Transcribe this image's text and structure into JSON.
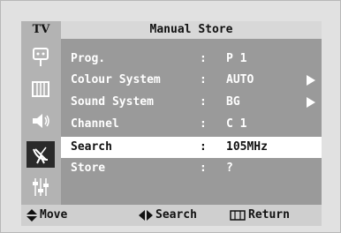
{
  "header": {
    "source": "TV",
    "title": "Manual Store"
  },
  "sidebar": {
    "icons": [
      {
        "name": "input-icon"
      },
      {
        "name": "picture-icon"
      },
      {
        "name": "sound-icon"
      },
      {
        "name": "channel-icon",
        "active": true
      },
      {
        "name": "setup-icon"
      }
    ]
  },
  "menu": {
    "rows": [
      {
        "label": "Prog.",
        "colon": ":",
        "value": "P 1",
        "has_arrow": false
      },
      {
        "label": "Colour System",
        "colon": ":",
        "value": "AUTO",
        "has_arrow": true
      },
      {
        "label": "Sound System",
        "colon": ":",
        "value": "BG",
        "has_arrow": true
      },
      {
        "label": "Channel",
        "colon": ":",
        "value": "C 1",
        "has_arrow": false
      },
      {
        "label": "Search",
        "colon": ":",
        "value": "105MHz",
        "has_arrow": false,
        "selected": true
      },
      {
        "label": "Store",
        "colon": ":",
        "value": "?",
        "has_arrow": false
      }
    ]
  },
  "help": {
    "move_label": "Move",
    "search_label": "Search",
    "return_label": "Return"
  },
  "colors": {
    "panel": "#9a9a9a",
    "sidebar": "#b3b3b3",
    "selected_row": "#ffffff",
    "active_icon_bg": "#2a2a2a"
  }
}
